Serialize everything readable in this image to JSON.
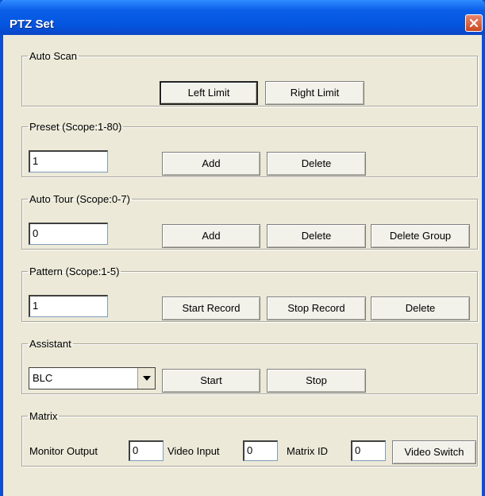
{
  "window": {
    "title": "PTZ Set"
  },
  "auto_scan": {
    "legend": "Auto Scan",
    "left_limit": "Left Limit",
    "right_limit": "Right Limit"
  },
  "preset": {
    "legend": "Preset (Scope:1-80)",
    "value": "1",
    "add": "Add",
    "delete": "Delete"
  },
  "auto_tour": {
    "legend": "Auto Tour (Scope:0-7)",
    "value": "0",
    "add": "Add",
    "delete": "Delete",
    "delete_group": "Delete Group"
  },
  "pattern": {
    "legend": "Pattern (Scope:1-5)",
    "value": "1",
    "start_record": "Start Record",
    "stop_record": "Stop Record",
    "delete": "Delete"
  },
  "assistant": {
    "legend": "Assistant",
    "selected": "BLC",
    "start": "Start",
    "stop": "Stop"
  },
  "matrix": {
    "legend": "Matrix",
    "monitor_output_label": "Monitor Output",
    "monitor_output_value": "0",
    "video_input_label": "Video Input",
    "video_input_value": "0",
    "matrix_id_label": "Matrix ID",
    "matrix_id_value": "0",
    "video_switch": "Video Switch"
  }
}
